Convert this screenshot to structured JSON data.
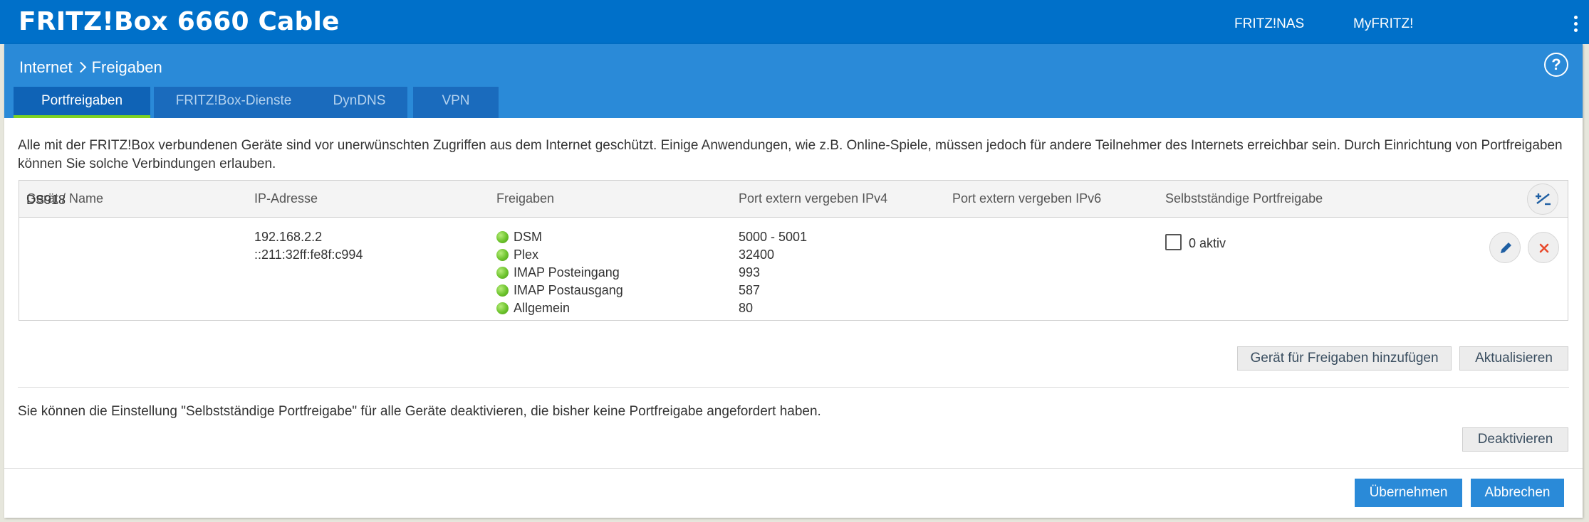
{
  "topbar": {
    "brand": "FRITZ!Box 6660 Cable",
    "links": [
      "FRITZ!NAS",
      "MyFRITZ!"
    ],
    "menu_icon": "vertical-dots-icon"
  },
  "breadcrumb": {
    "parent": "Internet",
    "current": "Freigaben"
  },
  "help_label": "?",
  "tabs": [
    {
      "label": "Portfreigaben",
      "active": true
    },
    {
      "label": "FRITZ!Box-Dienste",
      "active": false
    },
    {
      "label": "DynDNS",
      "active": false
    },
    {
      "label": "VPN",
      "active": false
    }
  ],
  "intro": "Alle mit der FRITZ!Box verbundenen Geräte sind vor unerwünschten Zugriffen aus dem Internet geschützt. Einige Anwendungen, wie z.B. Online-Spiele, müssen jedoch für andere Teilnehmer des Internets erreichbar sein. Durch Einrichtung von Portfreigaben können Sie solche Verbindungen erlauben.",
  "table": {
    "headers": [
      "Gerät / Name",
      "IP-Adresse",
      "Freigaben",
      "Port extern vergeben IPv4",
      "Port extern vergeben IPv6",
      "Selbstständige Portfreigabe"
    ],
    "row": {
      "name": "DS918",
      "ipv4": "192.168.2.2",
      "ipv6": "::211:32ff:fe8f:c994",
      "shares": [
        {
          "name": "DSM",
          "port": "5000 - 5001"
        },
        {
          "name": "Plex",
          "port": "32400"
        },
        {
          "name": "IMAP Posteingang",
          "port": "993"
        },
        {
          "name": "IMAP Postausgang",
          "port": "587"
        },
        {
          "name": "Allgemein",
          "port": "80"
        }
      ],
      "self_share_label": "0 aktiv"
    }
  },
  "buttons": {
    "add_device": "Gerät für Freigaben hinzufügen",
    "refresh": "Aktualisieren",
    "deactivate": "Deaktivieren",
    "apply": "Übernehmen",
    "cancel": "Abbrechen"
  },
  "deactivate_text": "Sie können die Einstellung \"Selbstständige Portfreigabe\" für alle Geräte deaktivieren, die bisher keine Portfreigabe angefordert haben.",
  "colors": {
    "topbar": "#0070c9",
    "header": "#2a8ad8",
    "active_tab_underline": "#7ed321",
    "status_green": "#6cc32c",
    "delete_red": "#e8492b"
  }
}
